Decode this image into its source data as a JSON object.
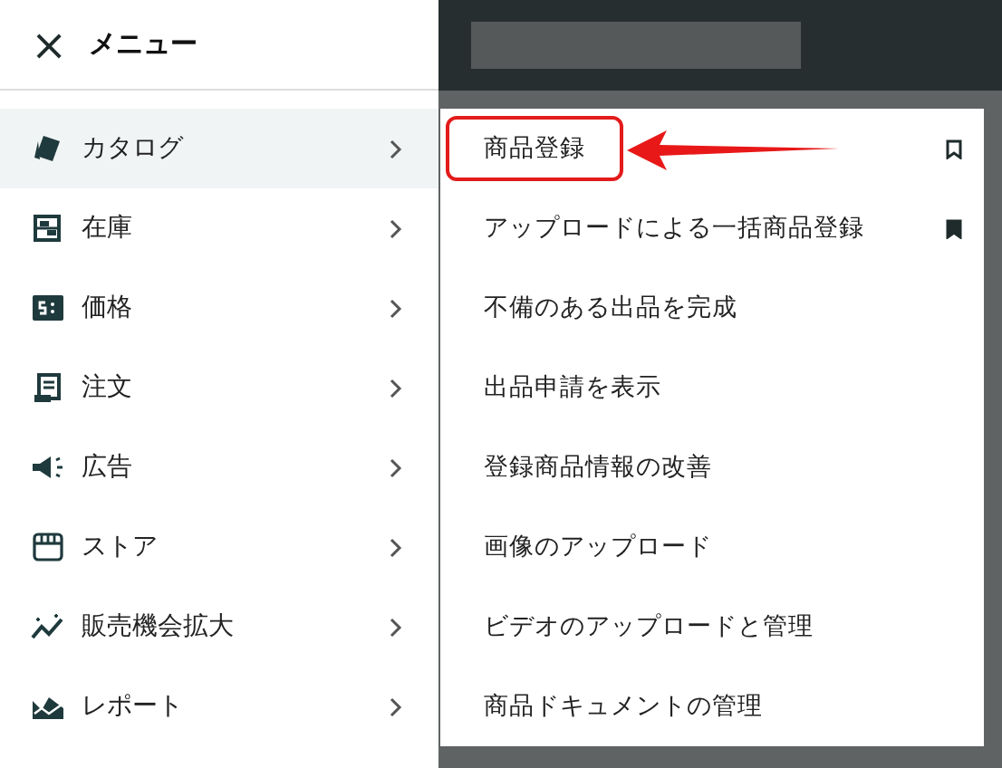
{
  "menu": {
    "close": "×",
    "title": "メニュー"
  },
  "items": [
    {
      "label": "カタログ",
      "selected": true
    },
    {
      "label": "在庫",
      "selected": false
    },
    {
      "label": "価格",
      "selected": false
    },
    {
      "label": "注文",
      "selected": false
    },
    {
      "label": "広告",
      "selected": false
    },
    {
      "label": "ストア",
      "selected": false
    },
    {
      "label": "販売機会拡大",
      "selected": false
    },
    {
      "label": "レポート",
      "selected": false
    }
  ],
  "submenu": [
    {
      "label": "商品登録",
      "highlighted": true,
      "pinned": false
    },
    {
      "label": "アップロードによる一括商品登録",
      "highlighted": false,
      "pinned": true
    },
    {
      "label": "不備のある出品を完成",
      "highlighted": false
    },
    {
      "label": "出品申請を表示",
      "highlighted": false
    },
    {
      "label": "登録商品情報の改善",
      "highlighted": false
    },
    {
      "label": "画像のアップロード",
      "highlighted": false
    },
    {
      "label": "ビデオのアップロードと管理",
      "highlighted": false
    },
    {
      "label": "商品ドキュメントの管理",
      "highlighted": false
    }
  ]
}
